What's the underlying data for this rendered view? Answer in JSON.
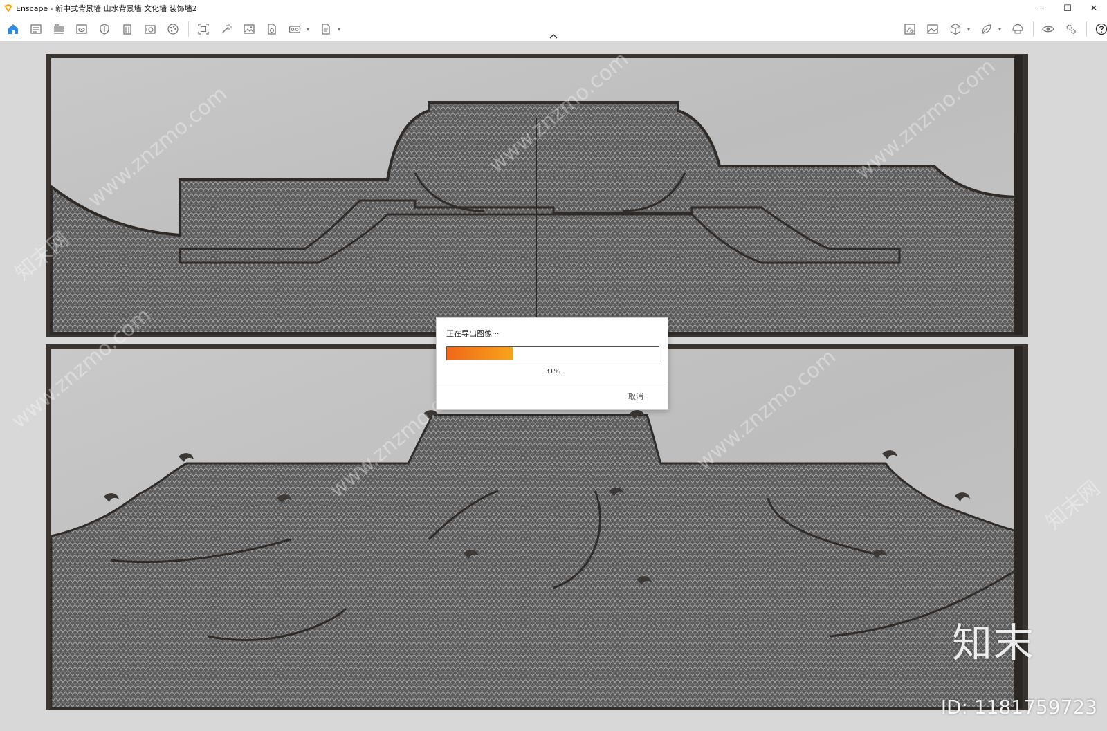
{
  "window": {
    "title": "Enscape - 新中式背景墙 山水背景墙 文化墙 装饰墙2",
    "minimize_glyph": "─",
    "maximize_glyph": "☐",
    "close_glyph": "✕"
  },
  "toolbar": {
    "left_icons": [
      "home-icon",
      "sync-views-icon",
      "bim-icon",
      "eye-view-icon",
      "shield-icon",
      "building-icon",
      "camera-info-icon",
      "palette-icon",
      "frame-icon",
      "magic-wand-icon",
      "image-icon",
      "export-file-icon",
      "vr-headset-icon",
      "document-icon"
    ],
    "right_icons": [
      "capture-icon",
      "gallery-icon",
      "cube-icon",
      "leaf-icon",
      "helmet-icon",
      "visibility-icon",
      "settings-icon",
      "help-icon"
    ]
  },
  "colors": {
    "accent_home": "#2b8be6",
    "progress_start": "#f06818",
    "progress_end": "#f7a41a"
  },
  "dialog": {
    "title": "正在导出图像···",
    "progress_fraction": 0.31,
    "progress_text": "31%",
    "cancel_label": "取消"
  },
  "watermark": {
    "repeat_text": "www.znzmo.com",
    "side_text": "知末网",
    "brand": "知末",
    "id_text": "ID: 1181759723"
  }
}
